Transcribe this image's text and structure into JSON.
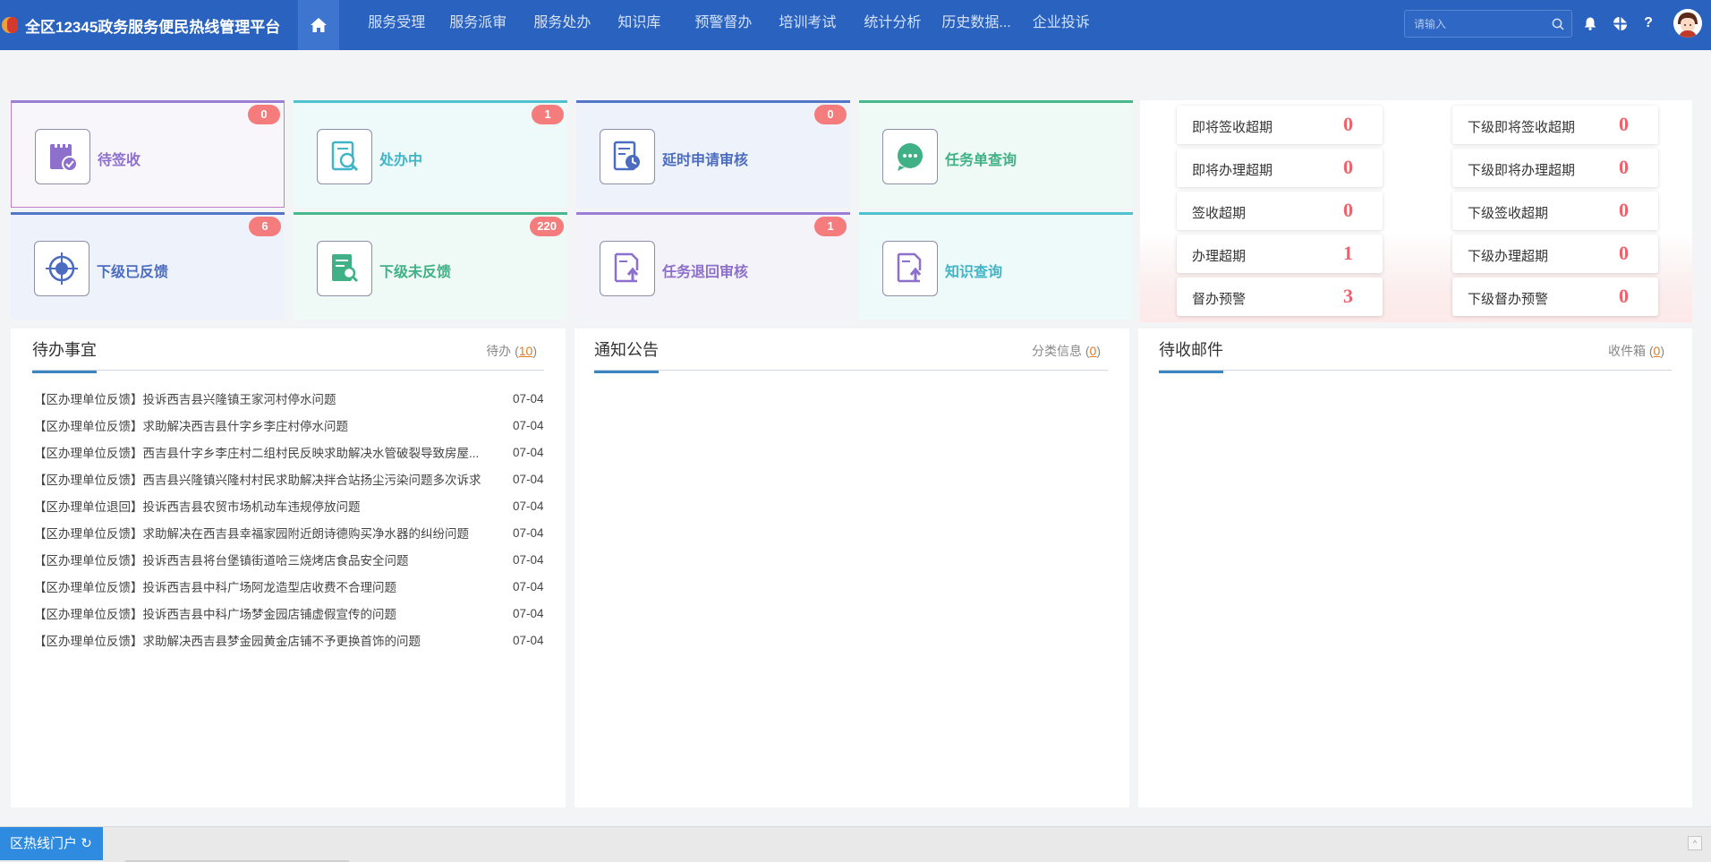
{
  "app": {
    "title": "全区12345政务服务便民热线管理平台"
  },
  "nav": [
    "服务受理",
    "服务派审",
    "服务处办",
    "知识库",
    "预警督办",
    "培训考试",
    "统计分析",
    "历史数据...",
    "企业投诉"
  ],
  "search": {
    "placeholder": "请输入"
  },
  "colors": {
    "topbar": "#2a63bf",
    "badge": "#f47c7c",
    "alert_value": "#f0626b",
    "accent_tab": "#3c86bf",
    "count_link": "#e07b22"
  },
  "tiles": [
    {
      "label": "待签收",
      "badge": "0",
      "icon": "clipboard-check-icon",
      "color": "#8d6fcc"
    },
    {
      "label": "处办中",
      "badge": "1",
      "icon": "document-search-icon",
      "color": "#3fb5c7"
    },
    {
      "label": "延时申请审核",
      "badge": "0",
      "icon": "document-clock-icon",
      "color": "#4b6cc0"
    },
    {
      "label": "任务单查询",
      "badge": "",
      "icon": "chat-bubble-icon",
      "color": "#40b186"
    },
    {
      "label": "下级已反馈",
      "badge": "6",
      "icon": "target-icon",
      "color": "#4b6cc0"
    },
    {
      "label": "下级未反馈",
      "badge": "220",
      "icon": "report-search-icon",
      "color": "#40b186"
    },
    {
      "label": "任务退回审核",
      "badge": "1",
      "icon": "document-upload-icon",
      "color": "#8d6fcc"
    },
    {
      "label": "知识查询",
      "badge": "",
      "icon": "document-upload-icon",
      "color": "#3fb5c7"
    }
  ],
  "alerts": {
    "left": [
      {
        "label": "即将签收超期",
        "value": "0"
      },
      {
        "label": "即将办理超期",
        "value": "0"
      },
      {
        "label": "签收超期",
        "value": "0"
      },
      {
        "label": "办理超期",
        "value": "1"
      },
      {
        "label": "督办预警",
        "value": "3"
      }
    ],
    "right": [
      {
        "label": "下级即将签收超期",
        "value": "0"
      },
      {
        "label": "下级即将办理超期",
        "value": "0"
      },
      {
        "label": "下级签收超期",
        "value": "0"
      },
      {
        "label": "下级办理超期",
        "value": "0"
      },
      {
        "label": "下级督办预警",
        "value": "0"
      }
    ]
  },
  "todo": {
    "title": "待办事宜",
    "meta_label": "待办",
    "count": "10",
    "items": [
      {
        "text": "【区办理单位反馈】投诉西吉县兴隆镇王家河村停水问题",
        "date": "07-04"
      },
      {
        "text": "【区办理单位反馈】求助解决西吉县什字乡李庄村停水问题",
        "date": "07-04"
      },
      {
        "text": "【区办理单位反馈】西吉县什字乡李庄村二组村民反映求助解决水管破裂导致房屋...",
        "date": "07-04"
      },
      {
        "text": "【区办理单位反馈】西吉县兴隆镇兴隆村村民求助解决拌合站扬尘污染问题多次诉求",
        "date": "07-04"
      },
      {
        "text": "【区办理单位退回】投诉西吉县农贸市场机动车违规停放问题",
        "date": "07-04"
      },
      {
        "text": "【区办理单位反馈】求助解决在西吉县幸福家园附近朗诗德购买净水器的纠纷问题",
        "date": "07-04"
      },
      {
        "text": "【区办理单位反馈】投诉西吉县将台堡镇街道哈三烧烤店食品安全问题",
        "date": "07-04"
      },
      {
        "text": "【区办理单位反馈】投诉西吉县中科广场阿龙造型店收费不合理问题",
        "date": "07-04"
      },
      {
        "text": "【区办理单位反馈】投诉西吉县中科广场梦金园店铺虚假宣传的问题",
        "date": "07-04"
      },
      {
        "text": "【区办理单位反馈】求助解决西吉县梦金园黄金店铺不予更换首饰的问题",
        "date": "07-04"
      }
    ]
  },
  "notice": {
    "title": "通知公告",
    "meta_label": "分类信息",
    "count": "0"
  },
  "mail": {
    "title": "待收邮件",
    "meta_label": "收件箱",
    "count": "0"
  },
  "footer": {
    "portal_label": "区热线门户"
  }
}
